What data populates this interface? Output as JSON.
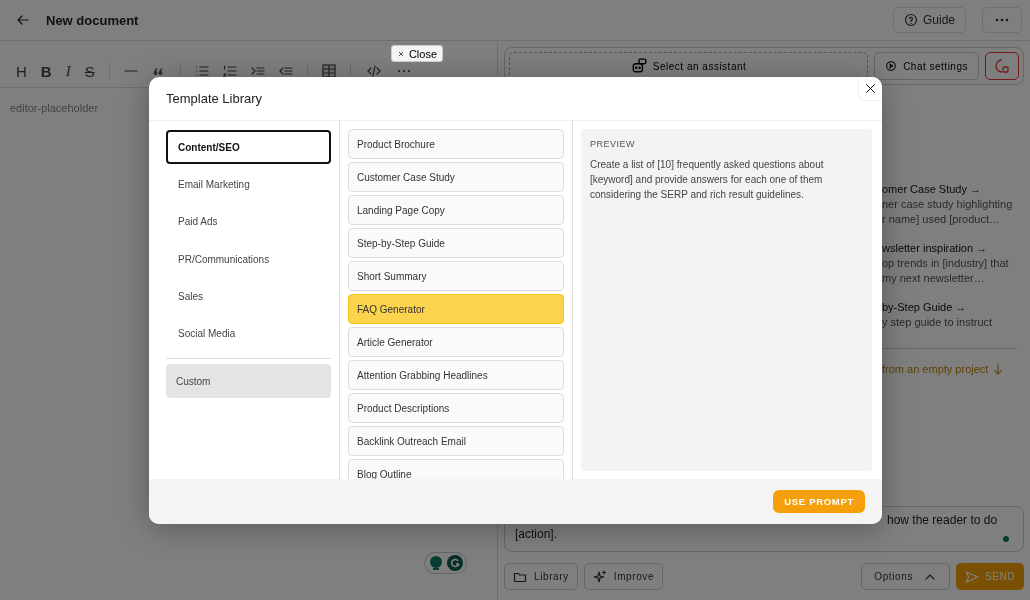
{
  "header": {
    "title": "New document",
    "guide_button": "Guide"
  },
  "editor": {
    "close_button": "Close",
    "toolbar": [
      {
        "label": "H",
        "kind": "plain"
      },
      {
        "label": "B",
        "kind": "bold"
      },
      {
        "label": "I",
        "kind": "italic"
      },
      {
        "label": "S",
        "kind": "strike"
      }
    ],
    "placeholder": "editor-placeholder"
  },
  "assistant_bar": {
    "select_assistant": "Select an assistant",
    "chat_settings": "Chat settings"
  },
  "suggestions": [
    {
      "title": "omer Case Study →",
      "lines": [
        "ner case study highlighting",
        "r name] used [product…"
      ]
    },
    {
      "title": "wsletter inspiration →",
      "lines": [
        "op trends in [industry] that",
        "my next newsletter…"
      ]
    },
    {
      "title": "by-Step Guide →",
      "lines": [
        "y step guide to instruct"
      ]
    }
  ],
  "empty_project": "from an empty project",
  "prompt": {
    "lines": [
      "how the reader to do",
      "[action]."
    ]
  },
  "bottom_bar": {
    "library": "Library",
    "improve": "Improve",
    "options": "Options",
    "send": "SEND"
  },
  "modal": {
    "title": "Template Library",
    "categories": [
      {
        "label": "Content/SEO",
        "selected": true
      },
      {
        "label": "Email Marketing",
        "selected": false
      },
      {
        "label": "Paid Ads",
        "selected": false
      },
      {
        "label": "PR/Communications",
        "selected": false
      },
      {
        "label": "Sales",
        "selected": false
      },
      {
        "label": "Social Media",
        "selected": false
      }
    ],
    "custom": "Custom",
    "templates": [
      {
        "label": "Product Brochure",
        "selected": false
      },
      {
        "label": "Customer Case Study",
        "selected": false
      },
      {
        "label": "Landing Page Copy",
        "selected": false
      },
      {
        "label": "Step-by-Step Guide",
        "selected": false
      },
      {
        "label": "Short Summary",
        "selected": false
      },
      {
        "label": "FAQ Generator",
        "selected": true
      },
      {
        "label": "Article Generator",
        "selected": false
      },
      {
        "label": "Attention Grabbing Headlines",
        "selected": false
      },
      {
        "label": "Product Descriptions",
        "selected": false
      },
      {
        "label": "Backlink Outreach Email",
        "selected": false
      },
      {
        "label": "Blog Outline",
        "selected": false
      }
    ],
    "preview_label": "PREVIEW",
    "preview_text": "Create a list of [10] frequently asked questions about [keyword] and provide answers for each one of them considering the SERP and rich result guidelines.",
    "use_prompt": "USE PROMPT"
  }
}
